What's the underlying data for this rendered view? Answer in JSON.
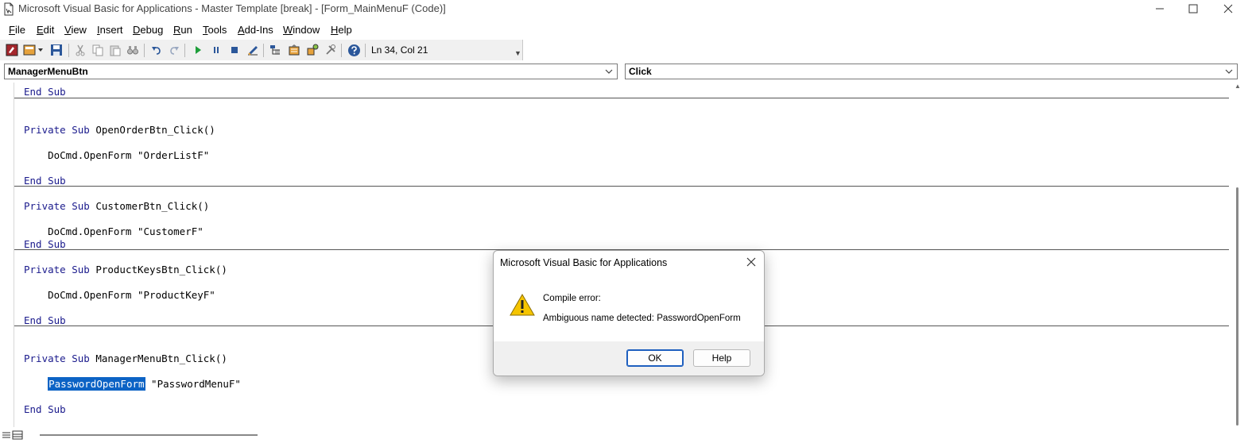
{
  "window": {
    "title": "Microsoft Visual Basic for Applications - Master Template [break] - [Form_MainMenuF (Code)]"
  },
  "menu": [
    "File",
    "Edit",
    "View",
    "Insert",
    "Debug",
    "Run",
    "Tools",
    "Add-Ins",
    "Window",
    "Help"
  ],
  "toolbar": {
    "cursor_position": "Ln 34, Col 21"
  },
  "object_combo": {
    "value": "ManagerMenuBtn"
  },
  "procedure_combo": {
    "value": "Click"
  },
  "code": {
    "l1": "End Sub",
    "l2_kw": "Private Sub",
    "l2_rest": " OpenOrderBtn_Click()",
    "l3": "    DoCmd.OpenForm \"OrderListF\"",
    "l4": "End Sub",
    "l5_kw": "Private Sub",
    "l5_rest": " CustomerBtn_Click()",
    "l6": "    DoCmd.OpenForm \"CustomerF\"",
    "l7": "End Sub",
    "l8_kw": "Private Sub",
    "l8_rest": " ProductKeysBtn_Click()",
    "l9": "    DoCmd.OpenForm \"ProductKeyF\"",
    "l10": "End Sub",
    "l11_kw": "Private Sub",
    "l11_rest": " ManagerMenuBtn_Click()",
    "l12_indent": "    ",
    "l12_sel": "PasswordOpenForm",
    "l12_rest": " \"PasswordMenuF\"",
    "l13": "End Sub"
  },
  "dialog": {
    "title": "Microsoft Visual Basic for Applications",
    "heading": "Compile error:",
    "message": "Ambiguous name detected: PasswordOpenForm",
    "ok_label": "OK",
    "help_label": "Help"
  },
  "colors": {
    "keyword": "#1a1a8c",
    "selection": "#0c63c5",
    "warning": "#f5c400"
  }
}
